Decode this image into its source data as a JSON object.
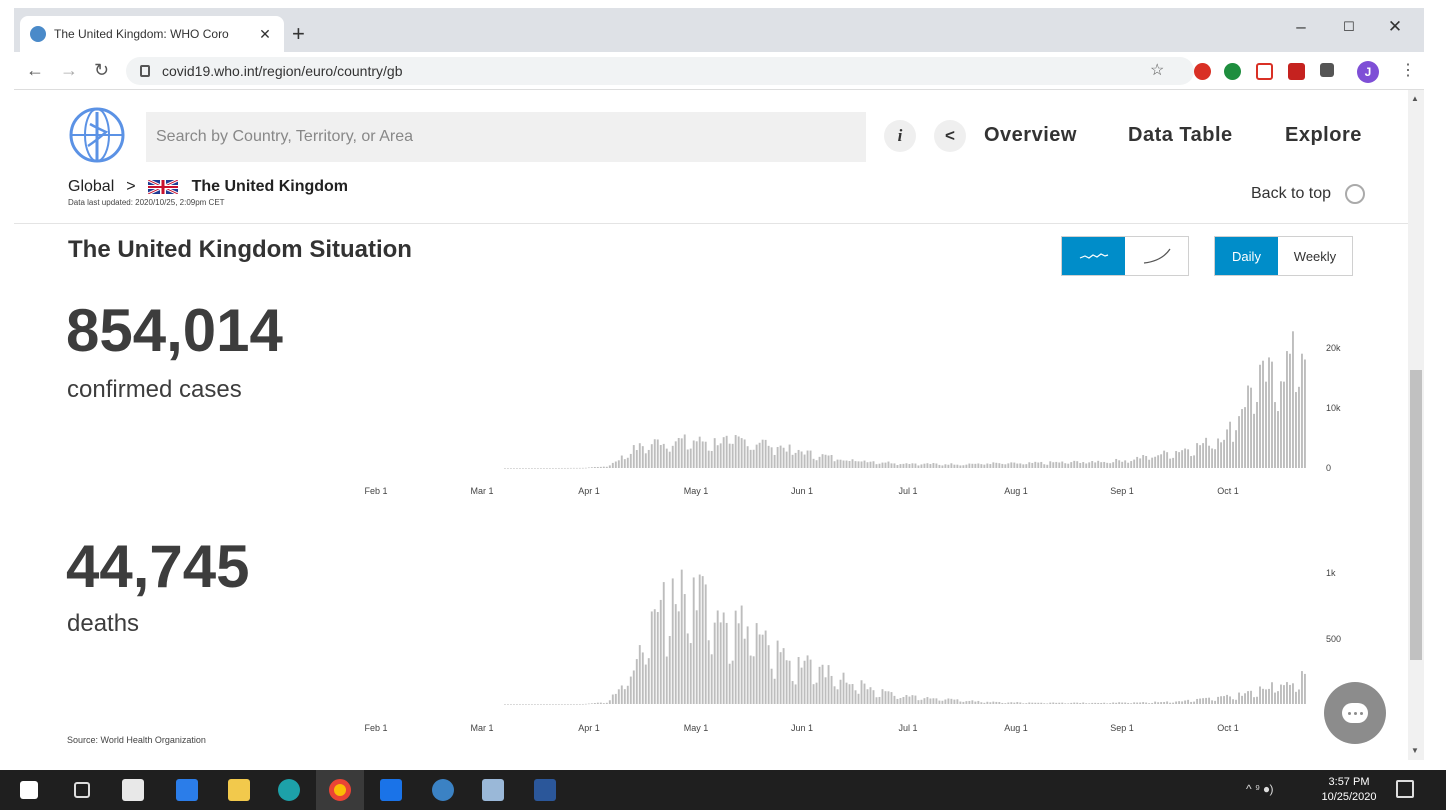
{
  "browser": {
    "tab_title": "The United Kingdom: WHO Coro",
    "tab_close": "✕",
    "new_tab": "+",
    "url": "covid19.who.int/region/euro/country/gb",
    "window_controls": [
      "–",
      "☐",
      "✕"
    ],
    "avatar_letter": "J"
  },
  "header": {
    "search_placeholder": "Search by Country, Territory, or Area",
    "info_label": "i",
    "share_label": "<",
    "nav": [
      "Overview",
      "Data Table",
      "Explore"
    ],
    "breadcrumb_global": "Global",
    "breadcrumb_sep": ">",
    "breadcrumb_country": "The United Kingdom",
    "last_updated": "Data last updated: 2020/10/25, 2:09pm CET",
    "back_to_top": "Back to top"
  },
  "situation": {
    "title": "The United Kingdom Situation",
    "view_toggle": [
      "line-icon",
      "cumulative-icon"
    ],
    "period_toggle": [
      "Daily",
      "Weekly"
    ],
    "active_period": "Daily",
    "cases_value": "854,014",
    "cases_label": "confirmed cases",
    "deaths_value": "44,745",
    "deaths_label": "deaths",
    "source": "Source:  World Health Organization"
  },
  "chart_data": [
    {
      "type": "bar",
      "title": "",
      "series": [
        {
          "name": "confirmed cases",
          "values_weekly_avg": [
            0,
            0,
            0,
            20,
            300,
            3200,
            4500,
            4600,
            4400,
            4700,
            4300,
            3200,
            2300,
            1600,
            1200,
            900,
            750,
            650,
            700,
            800,
            750,
            900,
            1000,
            1100,
            1300,
            2000,
            2800,
            3900,
            5800,
            14000,
            16000,
            21000
          ]
        }
      ],
      "x_ticks": [
        "Feb 1",
        "Mar 1",
        "Apr 1",
        "May 1",
        "Jun 1",
        "Jul 1",
        "Aug 1",
        "Sep 1",
        "Oct 1"
      ],
      "y_ticks": [
        "0",
        "10k",
        "20k"
      ],
      "ylim": [
        0,
        26000
      ]
    },
    {
      "type": "bar",
      "title": "",
      "series": [
        {
          "name": "deaths",
          "values_weekly_avg": [
            0,
            0,
            0,
            0,
            15,
            280,
            800,
            950,
            820,
            700,
            500,
            380,
            300,
            220,
            150,
            80,
            60,
            40,
            25,
            15,
            12,
            10,
            10,
            10,
            12,
            15,
            20,
            40,
            60,
            100,
            160,
            230
          ]
        }
      ],
      "x_ticks": [
        "Feb 1",
        "Mar 1",
        "Apr 1",
        "May 1",
        "Jun 1",
        "Jul 1",
        "Aug 1",
        "Sep 1",
        "Oct 1"
      ],
      "y_ticks": [
        "500",
        "1k"
      ],
      "ylim": [
        0,
        1250
      ]
    }
  ],
  "taskbar": {
    "clock_time": "3:57 PM",
    "clock_date": "10/25/2020",
    "tray_text": "^ ⁹ ⦁)"
  }
}
